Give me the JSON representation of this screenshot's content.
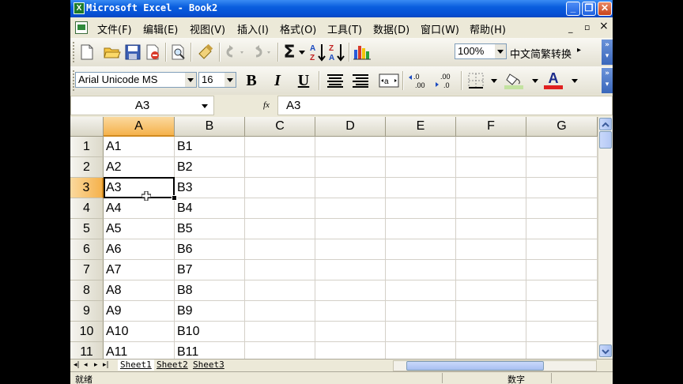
{
  "window": {
    "title": "Microsoft Excel - Book2"
  },
  "menu": {
    "items": [
      "文件(F)",
      "编辑(E)",
      "视图(V)",
      "插入(I)",
      "格式(O)",
      "工具(T)",
      "数据(D)",
      "窗口(W)",
      "帮助(H)"
    ],
    "close_doc": "×"
  },
  "toolbar1": {
    "icons": [
      "new-icon",
      "open-icon",
      "save-icon",
      "permission-icon",
      "print-preview-icon",
      "format-painter-icon",
      "undo-icon",
      "redo-icon",
      "autosum-icon",
      "sort-ascending-icon",
      "sort-descending-icon",
      "chart-wizard-icon"
    ],
    "zoom": "100%",
    "chinese_convert": "中文简繁转换"
  },
  "toolbar2": {
    "font_name": "Arial Unicode MS",
    "font_size": "16",
    "bold": "B",
    "italic": "I",
    "underline": "U",
    "fill_color": "#c3e2a0",
    "font_color": "#e02020"
  },
  "formula_bar": {
    "name_box": "A3",
    "fx": "fx",
    "content": "A3"
  },
  "grid": {
    "columns": [
      "A",
      "B",
      "C",
      "D",
      "E",
      "F",
      "G"
    ],
    "active_column": "A",
    "active_row": "3",
    "rows": [
      {
        "num": "1",
        "a": "A1",
        "b": "B1"
      },
      {
        "num": "2",
        "a": "A2",
        "b": "B2"
      },
      {
        "num": "3",
        "a": "A3",
        "b": "B3"
      },
      {
        "num": "4",
        "a": "A4",
        "b": "B4"
      },
      {
        "num": "5",
        "a": "A5",
        "b": "B5"
      },
      {
        "num": "6",
        "a": "A6",
        "b": "B6"
      },
      {
        "num": "7",
        "a": "A7",
        "b": "B7"
      },
      {
        "num": "8",
        "a": "A8",
        "b": "B8"
      },
      {
        "num": "9",
        "a": "A9",
        "b": "B9"
      },
      {
        "num": "10",
        "a": "A10",
        "b": "B10"
      },
      {
        "num": "11",
        "a": "A11",
        "b": "B11"
      }
    ]
  },
  "sheets": [
    "Sheet1",
    "Sheet2",
    "Sheet3"
  ],
  "active_sheet": "Sheet1",
  "status": {
    "left": "就绪",
    "mode": "数字"
  }
}
